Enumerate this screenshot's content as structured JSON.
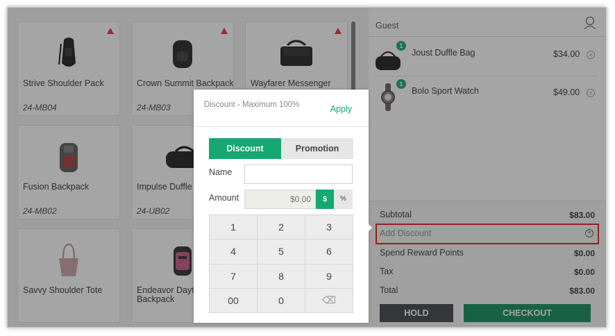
{
  "products": [
    {
      "name": "Strive Shoulder Pack",
      "sku": "24-MB04",
      "warning": true,
      "icon": "backpack-black-icon"
    },
    {
      "name": "Crown Summit Backpack",
      "sku": "24-MB03",
      "warning": true,
      "icon": "backpack-black-icon"
    },
    {
      "name": "Wayfarer Messenger",
      "sku": "",
      "warning": true,
      "icon": "messenger-bag-icon"
    },
    {
      "name": "Fusion Backpack",
      "sku": "24-MB02",
      "warning": false,
      "icon": "backpack-gray-icon"
    },
    {
      "name": "Impulse Duffle",
      "sku": "24-UB02",
      "warning": false,
      "icon": "duffle-bag-icon"
    },
    {
      "name": "Savvy Shoulder Tote",
      "sku": "",
      "warning": false,
      "icon": "tote-bag-icon"
    },
    {
      "name": "Endeavor Daytrip Backpack",
      "sku": "",
      "warning": false,
      "icon": "backpack-pink-icon"
    }
  ],
  "cart": {
    "customer": "Guest",
    "items": [
      {
        "name": "Joust Duffle Bag",
        "price": "$34.00",
        "qty": "1"
      },
      {
        "name": "Bolo Sport Watch",
        "price": "$49.00",
        "qty": "1"
      }
    ],
    "subtotal_label": "Subtotal",
    "subtotal": "$83.00",
    "add_discount_label": "Add Discount",
    "reward_label": "Spend Reward Points",
    "reward": "$0.00",
    "tax_label": "Tax",
    "tax": "$0.00",
    "total_label": "Total",
    "total": "$83.00",
    "hold_label": "HOLD",
    "checkout_label": "CHECKOUT"
  },
  "popup": {
    "title": "Discount - Maximum 100%",
    "apply_label": "Apply",
    "tab_discount": "Discount",
    "tab_promotion": "Promotion",
    "name_label": "Name",
    "name_value": "",
    "amount_label": "Amount",
    "amount_placeholder": "$0.00",
    "currency_label": "$",
    "percent_label": "%",
    "keys": [
      "1",
      "2",
      "3",
      "4",
      "5",
      "6",
      "7",
      "8",
      "9",
      "00",
      "0",
      "⌫"
    ]
  },
  "colors": {
    "accent": "#15a872",
    "checkout": "#0d8a5c",
    "hold": "#3d4046",
    "highlight": "#e31b1b",
    "warning": "#e03030"
  }
}
